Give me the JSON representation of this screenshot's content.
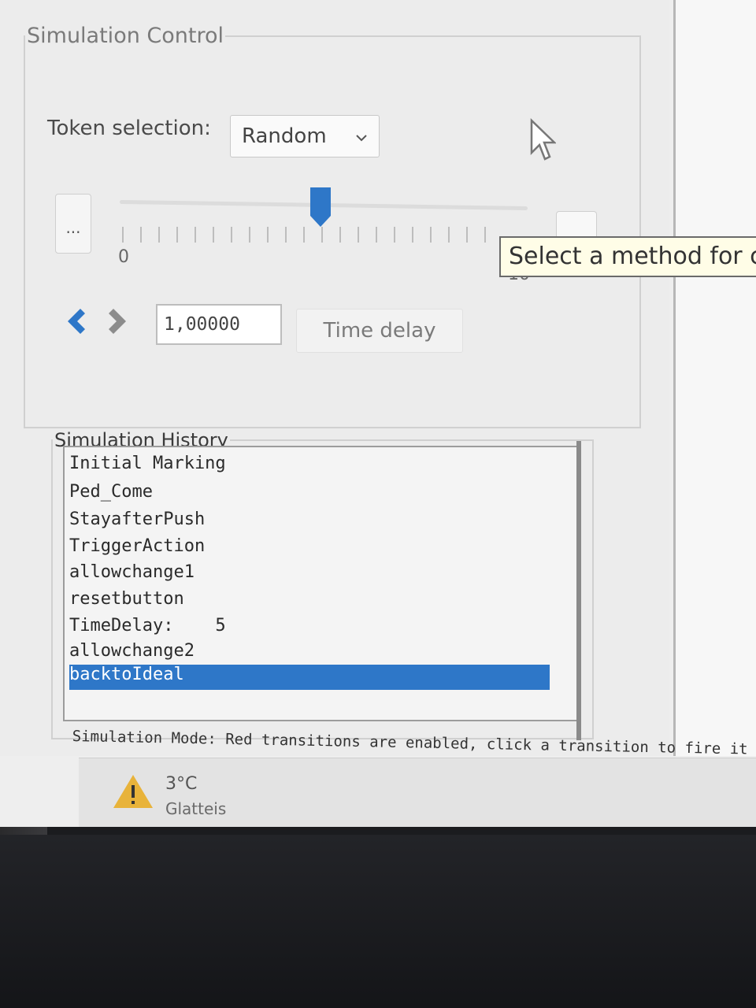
{
  "simulation_control": {
    "title": "Simulation Control",
    "token_selection_label": "Token selection:",
    "token_selection_value": "Random",
    "dots_button_label": "...",
    "slider": {
      "min_label": "0",
      "max_label": "10",
      "value": 5
    },
    "tooltip": "Select a method for c",
    "time_value": "1,00000",
    "time_delay_button": "Time delay"
  },
  "simulation_history": {
    "title": "Simulation History",
    "items": [
      "Initial Marking",
      "Ped_Come",
      "StayafterPush",
      "TriggerAction",
      "allowchange1",
      "resetbutton",
      "TimeDelay:    5",
      "allowchange2",
      "backtoIdeal"
    ],
    "selected_index": 8
  },
  "status_bar": {
    "text": "Simulation Mode: Red transitions are enabled, click a transition to fire it"
  },
  "taskbar": {
    "temperature": "3°C",
    "weather": "Glatteis"
  },
  "colors": {
    "accent": "#2e77c8",
    "warning": "#e8b33a"
  },
  "icons": [
    "chevron-down-icon",
    "slider-thumb-icon",
    "step-back-icon",
    "step-forward-icon",
    "mouse-cursor-icon",
    "warning-icon"
  ]
}
